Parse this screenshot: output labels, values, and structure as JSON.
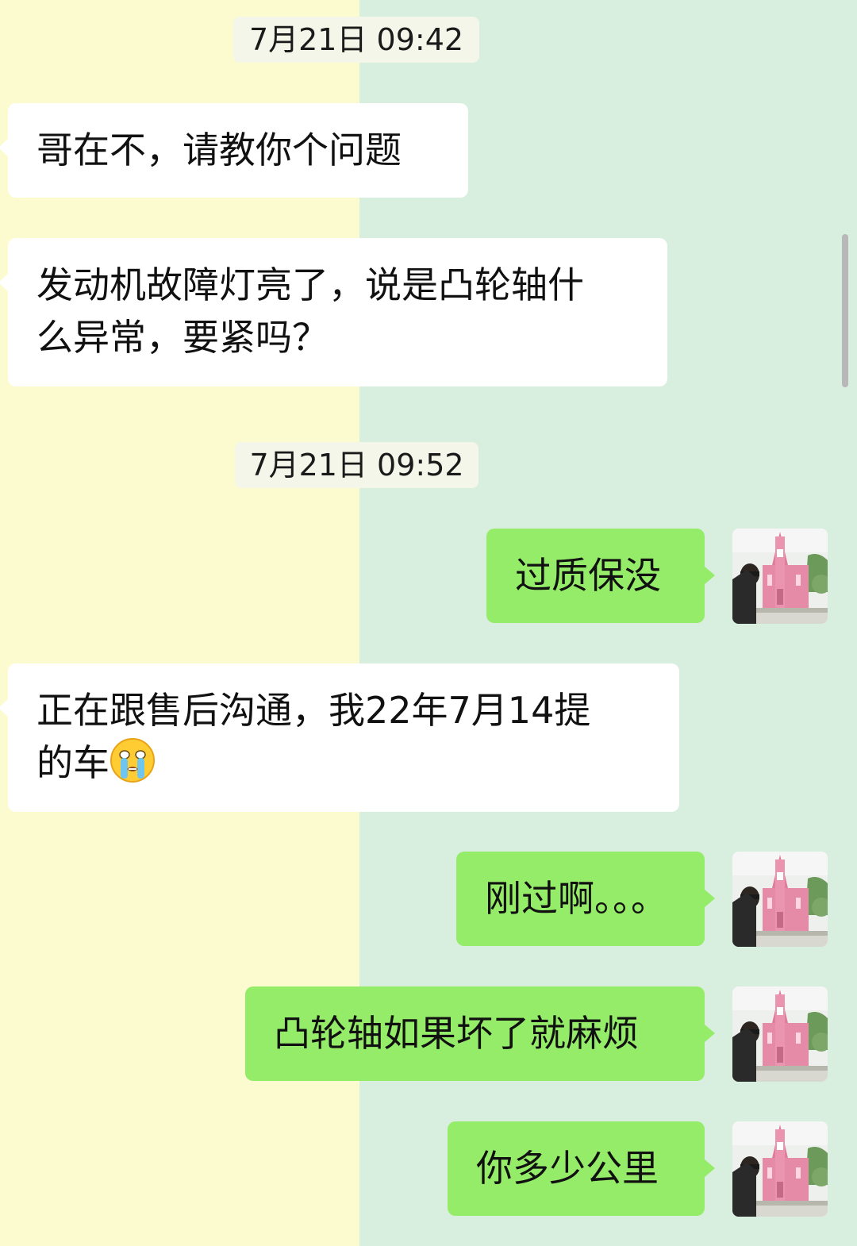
{
  "colors": {
    "bg_left": "#FCFBD0",
    "bg_right": "#D8EEDE",
    "received_bubble": "#FFFFFF",
    "sent_bubble": "#95EC69"
  },
  "messages": [
    {
      "type": "timestamp",
      "text": "7月21日 09:42"
    },
    {
      "type": "received",
      "text": "哥在不，请教你个问题"
    },
    {
      "type": "received",
      "lines": [
        "发动机故障灯亮了，说是凸轮轴什",
        "么异常，要紧吗？"
      ]
    },
    {
      "type": "timestamp",
      "text": "7月21日 09:52"
    },
    {
      "type": "sent",
      "text": "过质保没",
      "avatar_icon": "pink-church-selfie-avatar"
    },
    {
      "type": "received",
      "lines": [
        "正在跟售后沟通，我22年7月14提",
        "的车"
      ],
      "emoji_icon": "crying-face-emoji"
    },
    {
      "type": "sent",
      "text": "刚过啊。。。",
      "avatar_icon": "pink-church-selfie-avatar"
    },
    {
      "type": "sent",
      "text": "凸轮轴如果坏了就麻烦",
      "avatar_icon": "pink-church-selfie-avatar"
    },
    {
      "type": "sent",
      "text": "你多少公里",
      "avatar_icon": "pink-church-selfie-avatar"
    }
  ]
}
